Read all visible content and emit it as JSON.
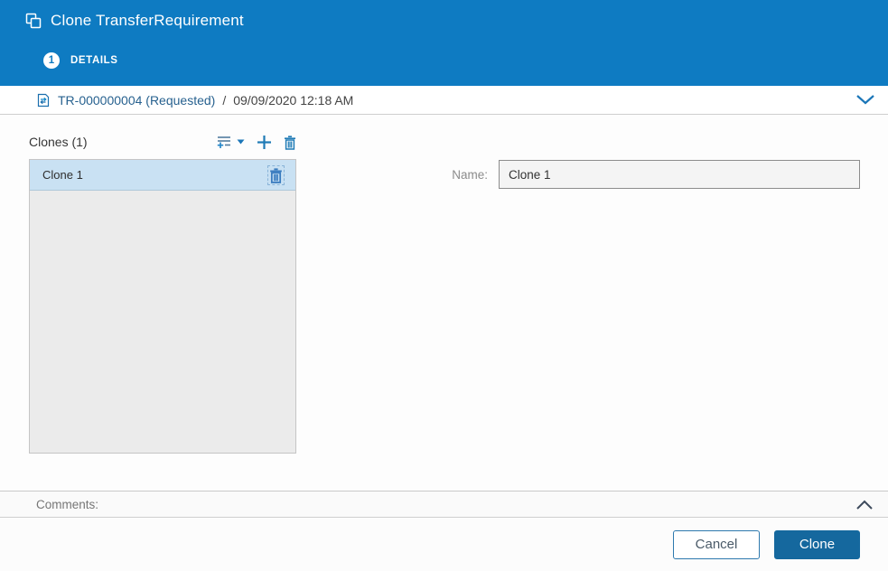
{
  "colors": {
    "header_bg": "#0e7bc2",
    "accent_blue": "#1b76b8",
    "primary_button_bg": "#15689e",
    "selected_row_bg": "#c9e1f3",
    "list_bg": "#ebebeb"
  },
  "header": {
    "title": "Clone TransferRequirement",
    "step_number": "1",
    "step_label": "DETAILS"
  },
  "breadcrumb": {
    "object_link": "TR-000000004 (Requested)",
    "separator": "/",
    "timestamp": "09/09/2020 12:18 AM"
  },
  "clones_panel": {
    "title": "Clones (1)",
    "items": [
      {
        "label": "Clone 1",
        "selected": true
      }
    ]
  },
  "form": {
    "name_label": "Name:",
    "name_value": "Clone 1"
  },
  "comments": {
    "label": "Comments:"
  },
  "footer": {
    "cancel_label": "Cancel",
    "clone_label": "Clone"
  },
  "icons": {
    "header_icon": "clone-icon",
    "breadcrumb_icon": "transfer-requirement-icon",
    "breadcrumb_right_icon": "chevron-down-icon",
    "toolbar_icons": [
      "add-rows-icon",
      "caret-down-icon",
      "plus-icon",
      "trash-icon"
    ],
    "row_icon": "trash-icon",
    "comments_right_icon": "chevron-up-icon"
  }
}
